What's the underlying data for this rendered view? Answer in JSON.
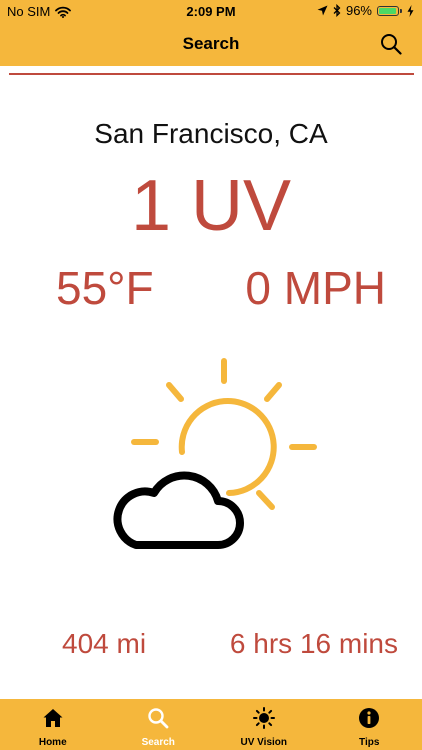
{
  "colors": {
    "accent": "#F5B73C",
    "red": "#BF4A3D",
    "sun": "#F5B73C",
    "cloud": "#000000",
    "active_tab": "#FFFFFF",
    "battery": "#4CD964"
  },
  "status_bar": {
    "carrier": "No SIM",
    "time": "2:09 PM",
    "battery": "96%",
    "battery_level": 0.96,
    "icons": [
      "wifi-icon",
      "location-arrow-icon",
      "bluetooth-icon",
      "battery-icon",
      "charging-icon"
    ]
  },
  "nav": {
    "title": "Search",
    "right_icon": "search-icon"
  },
  "main": {
    "city": "San Francisco, CA",
    "uv": "1 UV",
    "temperature": "55°F",
    "wind": "0 MPH",
    "weather_icon": "partly-cloudy-icon",
    "distance": "404 mi",
    "duration": "6 hrs 16 mins"
  },
  "tabs": [
    {
      "label": "Home",
      "icon": "home-icon",
      "active": false
    },
    {
      "label": "Search",
      "icon": "search-icon",
      "active": true
    },
    {
      "label": "UV Vision",
      "icon": "sun-icon",
      "active": false
    },
    {
      "label": "Tips",
      "icon": "info-icon",
      "active": false
    }
  ]
}
